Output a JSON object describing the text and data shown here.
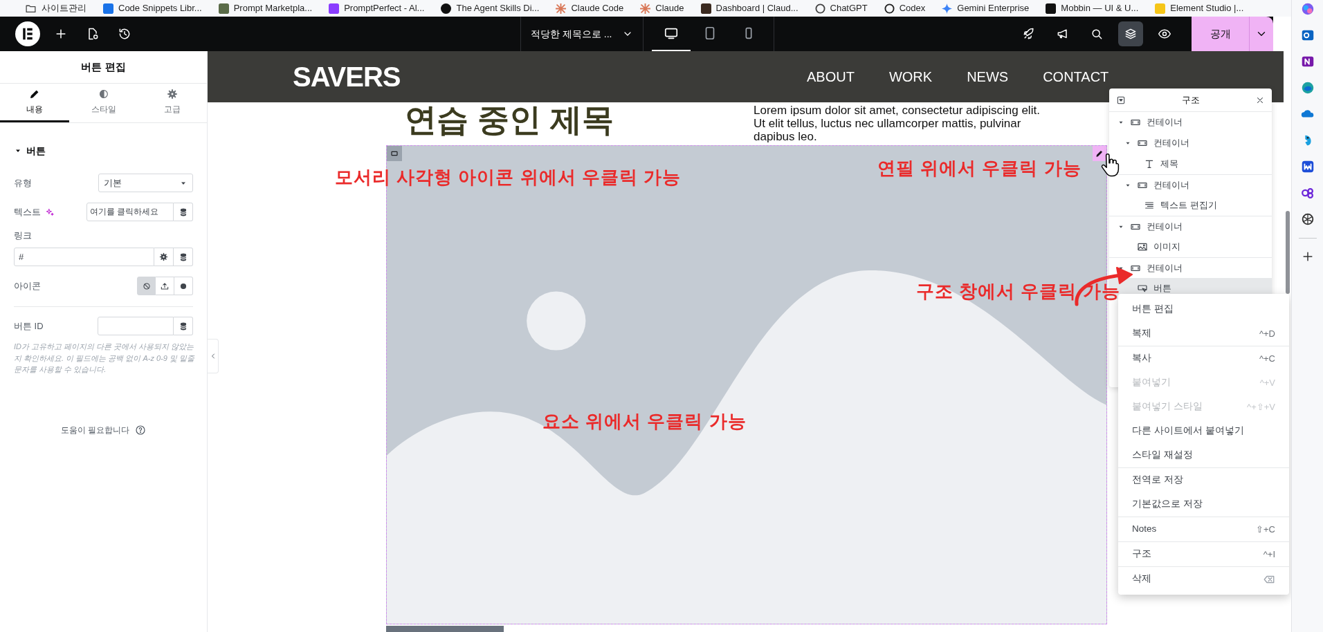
{
  "bookmarks_bar": {
    "items": [
      {
        "kind": "folder",
        "label": "사이트관리"
      },
      {
        "kind": "favicon",
        "label": "Code Snippets Libr...",
        "color": "#1a73e8"
      },
      {
        "kind": "favicon",
        "label": "Prompt Marketpla...",
        "color": "#5a6b48"
      },
      {
        "kind": "favicon",
        "label": "PromptPerfect - Al...",
        "color": "#8b3dff"
      },
      {
        "kind": "circle",
        "label": "The Agent Skills Di...",
        "color": "#111111"
      },
      {
        "kind": "burst",
        "label": "Claude Code",
        "color": "#d97757"
      },
      {
        "kind": "burst",
        "label": "Claude",
        "color": "#d97757"
      },
      {
        "kind": "favicon",
        "label": "Dashboard | Claud...",
        "color": "#3b2a20"
      },
      {
        "kind": "ring",
        "label": "ChatGPT",
        "color": "#444444"
      },
      {
        "kind": "ring",
        "label": "Codex",
        "color": "#222222"
      },
      {
        "kind": "star",
        "label": "Gemini Enterprise",
        "color": "#3b82f6"
      },
      {
        "kind": "favicon",
        "label": "Mobbin — UI & U...",
        "color": "#111111"
      },
      {
        "kind": "favicon",
        "label": "Element Studio |...",
        "color": "#f5c518"
      }
    ]
  },
  "toolbar": {
    "page_title": "적당한 제목으로 ...",
    "devices": [
      {
        "kind": "desktop",
        "selected": true
      },
      {
        "kind": "tablet",
        "selected": false
      },
      {
        "kind": "mobile",
        "selected": false
      }
    ],
    "tools": [
      {
        "kind": "rocket",
        "selected": false
      },
      {
        "kind": "megaphone",
        "selected": false
      },
      {
        "kind": "search",
        "selected": false
      },
      {
        "kind": "layers",
        "selected": true
      },
      {
        "kind": "eye",
        "selected": false
      }
    ],
    "publish": "공개"
  },
  "panel": {
    "title": "버튼 편집",
    "tabs": [
      {
        "kind": "pencil",
        "label": "내용",
        "selected": true
      },
      {
        "kind": "contrast",
        "label": "스타일",
        "selected": false
      },
      {
        "kind": "gear",
        "label": "고급",
        "selected": false
      }
    ],
    "section": {
      "title": "버튼",
      "expanded": true
    },
    "controls": [
      {
        "kind": "select",
        "label": "유형",
        "value": "기본",
        "ai": false
      },
      {
        "kind": "text",
        "label": "텍스트",
        "value": "여기를 클릭하세요",
        "ai": true
      },
      {
        "kind": "link",
        "label": "링크",
        "value": "#",
        "ai": false
      },
      {
        "kind": "choices",
        "label": "아이콘",
        "ai": false,
        "options": [
          {
            "kind": "none",
            "selected": true
          },
          {
            "kind": "upload",
            "selected": false
          },
          {
            "kind": "dot",
            "selected": false
          }
        ]
      },
      {
        "kind": "id",
        "label": "버튼 ID",
        "ai": false
      }
    ],
    "help": "ID가 고유하고 페이지의 다른 곳에서 사용되지 않았는지 확인하세요. 이 필드에는 공백 없이 A-z 0-9 및 밑줄 문자를 사용할 수 있습니다.",
    "help_link": "도움이 필요합니다"
  },
  "canvas": {
    "logo": "SAVERS",
    "nav": [
      "ABOUT",
      "WORK",
      "NEWS",
      "CONTACT"
    ],
    "heading": "연습 중인 제목",
    "paragraph": "Lorem ipsum dolor sit amet, consectetur adipiscing elit. Ut elit tellus, luctus nec ullamcorper mattis, pulvinar dapibus leo."
  },
  "structure": {
    "title": "구조",
    "tree": [
      {
        "kind": "container",
        "label": "컨테이너",
        "expanded": true,
        "selected": false,
        "children": [
          {
            "kind": "container",
            "label": "컨테이너",
            "expanded": true,
            "selected": false,
            "children": [
              {
                "kind": "heading",
                "label": "제목",
                "selected": false
              }
            ]
          },
          {
            "kind": "container",
            "label": "컨테이너",
            "expanded": true,
            "selected": false,
            "children": [
              {
                "kind": "text-editor",
                "label": "텍스트 편집기",
                "selected": false
              }
            ]
          }
        ]
      },
      {
        "kind": "container",
        "label": "컨테이너",
        "expanded": true,
        "selected": false,
        "children": [
          {
            "kind": "image",
            "label": "이미지",
            "selected": false
          }
        ]
      },
      {
        "kind": "container",
        "label": "컨테이너",
        "expanded": true,
        "selected": false,
        "children": [
          {
            "kind": "button",
            "label": "버튼",
            "selected": true
          }
        ]
      }
    ]
  },
  "context_menu": {
    "groups": [
      [
        {
          "kind": "shortcut",
          "label": "버튼 편집",
          "disabled": false
        },
        {
          "kind": "shortcut",
          "label": "복제",
          "shortcut": "^+D",
          "disabled": false
        }
      ],
      [
        {
          "kind": "shortcut",
          "label": "복사",
          "shortcut": "^+C",
          "disabled": false
        },
        {
          "kind": "shortcut",
          "label": "붙여넣기",
          "shortcut": "^+V",
          "disabled": true
        },
        {
          "kind": "shortcut",
          "label": "붙여넣기 스타일",
          "shortcut": "^+⇧+V",
          "disabled": true
        },
        {
          "kind": "shortcut",
          "label": "다른 사이트에서 붙여넣기",
          "disabled": false
        },
        {
          "kind": "shortcut",
          "label": "스타일 재설정",
          "disabled": false
        }
      ],
      [
        {
          "kind": "shortcut",
          "label": "전역로 저장",
          "disabled": false
        },
        {
          "kind": "shortcut",
          "label": "기본값으로 저장",
          "disabled": false
        }
      ],
      [
        {
          "kind": "shortcut",
          "label": "Notes",
          "shortcut": "⇧+C",
          "disabled": false
        }
      ],
      [
        {
          "kind": "shortcut",
          "label": "구조",
          "shortcut": "^+I",
          "disabled": false
        }
      ],
      [
        {
          "kind": "key-icon",
          "label": "삭제",
          "disabled": false
        }
      ]
    ]
  },
  "annotations": [
    {
      "text": "모서리 사각형 아이콘 위에서 우클릭 가능"
    },
    {
      "text": "연필 위에서 우클릭 가능"
    },
    {
      "text": "구조 창에서 우클릭 가능"
    },
    {
      "text": "요소 위에서 우클릭 가능"
    }
  ]
}
